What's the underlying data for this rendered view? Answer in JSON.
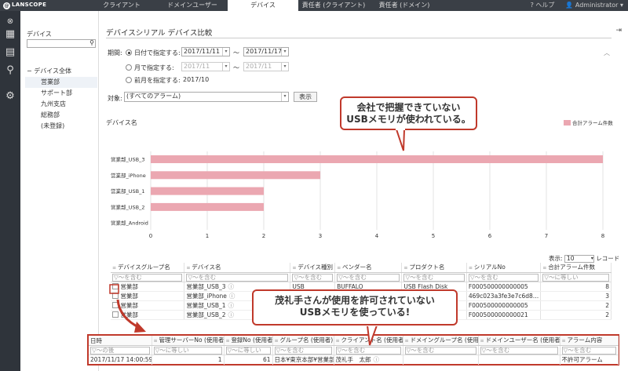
{
  "app": {
    "logo": "LANSCOPE",
    "logo_mark": "@"
  },
  "top_tabs": [
    {
      "label": "クライアント",
      "active": false
    },
    {
      "label": "ドメインユーザー",
      "active": false
    },
    {
      "label": "デバイス",
      "active": true
    },
    {
      "label": "責任者 (クライアント)",
      "active": false
    },
    {
      "label": "責任者 (ドメイン)",
      "active": false
    }
  ],
  "top_right": {
    "help": "ヘルプ",
    "user": "Administrator"
  },
  "tree": {
    "title": "デバイス",
    "root": "デバイス全体",
    "items": [
      "営業部",
      "サポート部",
      "九州支店",
      "総務部",
      "(未登録)"
    ],
    "selected": "営業部"
  },
  "page": {
    "title": "デバイスシリアル デバイス比較",
    "period_label": "期間:",
    "by_date": "日付で指定する:",
    "by_month": "月で指定する:",
    "prev_month": "前月を指定する:",
    "date_from": "2017/11/11",
    "date_to": "2017/11/17",
    "month_from": "2017/11",
    "month_to": "2017/11",
    "prev_month_value": "2017/10",
    "tilde": "〜",
    "target_label": "対象:",
    "target_value": "(すべてのアラーム)",
    "show_button": "表示"
  },
  "chart_data": {
    "type": "bar",
    "orientation": "horizontal",
    "ylabel": "デバイス名",
    "categories": [
      "営業部_USB_3",
      "営業部_iPhone",
      "営業部_USB_1",
      "営業部_USB_2",
      "営業部_Android"
    ],
    "series": [
      {
        "name": "合計アラーム件数",
        "values": [
          8,
          3,
          2,
          2,
          0
        ]
      }
    ],
    "xlim": [
      0,
      8
    ],
    "xticks": [
      0,
      1,
      2,
      3,
      4,
      5,
      6,
      7,
      8
    ],
    "grid": true,
    "legend": "top-right",
    "color": "#eba7b1"
  },
  "callout_top": {
    "line1": "会社で把握できていない",
    "line2": "USBメモリが使われている。"
  },
  "callout_bottom": {
    "line1": "茂礼手さんが使用を許可されていない",
    "line2": "USBメモリを使っている!"
  },
  "pager": {
    "label": "表示:",
    "value": "10",
    "unit": "レコード"
  },
  "device_table": {
    "headers": [
      "デバイスグループ名",
      "デバイス名",
      "デバイス種別",
      "ベンダー名",
      "プロダクト名",
      "シリアルNo",
      "合計アラーム件数"
    ],
    "filters": [
      "〜を含む",
      "〜を含む",
      "〜を含む",
      "〜を含む",
      "〜を含む",
      "〜を含む",
      "〜に等しい"
    ],
    "rows": [
      [
        "営業部",
        "営業部_USB_3",
        "USB",
        "BUFFALO",
        "USB Flash Disk",
        "F000500000000005",
        "8"
      ],
      [
        "営業部",
        "営業部_iPhone",
        "",
        "",
        "",
        "469c023a3fe3e7c6d8…",
        "3"
      ],
      [
        "営業部",
        "営業部_USB_1",
        "",
        "",
        "",
        "F000500000000005",
        "2"
      ],
      [
        "営業部",
        "営業部_USB_2",
        "",
        "",
        "",
        "F000500000000021",
        "2"
      ]
    ]
  },
  "detail_table": {
    "headers": [
      "日時",
      "管理サーバーNo (使用者)",
      "登録No (使用者)",
      "グループ名 (使用者)",
      "クライアント名 (使用者)",
      "ドメイングループ名 (使用者)",
      "ドメインユーザー名 (使用者)",
      "アラーム内容"
    ],
    "filters": [
      "〜の後",
      "〜に等しい",
      "〜に等しい",
      "〜を含む",
      "〜を含む",
      "〜を含む",
      "〜を含む",
      "〜を含む"
    ],
    "rows": [
      [
        "2017/11/17 14:00:59",
        "1",
        "61",
        "日本¥東京本部¥営業部",
        "茂礼手　太郎",
        "",
        "",
        "不許可アラーム"
      ]
    ]
  }
}
